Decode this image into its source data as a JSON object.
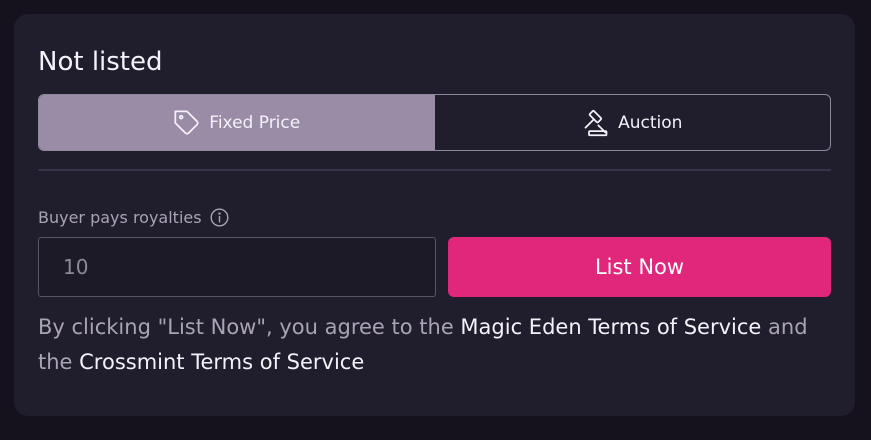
{
  "listing": {
    "status_title": "Not listed",
    "modes": [
      {
        "label": "Fixed Price",
        "icon": "price-tag-icon",
        "active": true
      },
      {
        "label": "Auction",
        "icon": "gavel-icon",
        "active": false
      }
    ],
    "royalties_label": "Buyer pays royalties",
    "royalties_info_icon": "info-icon",
    "price_input": {
      "value": "",
      "placeholder": "10"
    },
    "list_button_label": "List Now"
  },
  "terms": {
    "prefix": "By clicking \"List Now\", you agree to the ",
    "link1": "Magic Eden Terms of Service",
    "middle": " and the ",
    "link2": "Crossmint Terms of Service"
  },
  "colors": {
    "page_background": "#15111d",
    "card_background": "#201d2c",
    "active_tab": "#9a8ca7",
    "accent": "#e1277b",
    "muted_text": "#a9a3b5",
    "text": "#f4f2f8"
  }
}
